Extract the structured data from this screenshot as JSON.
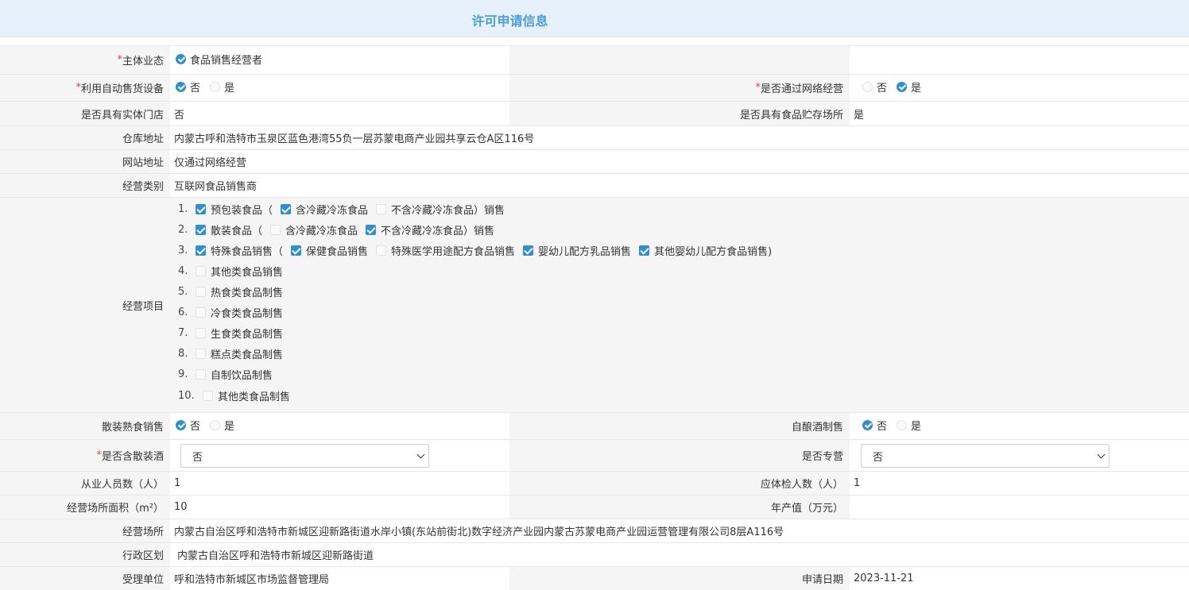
{
  "header": {
    "title": "许可申请信息"
  },
  "rows": {
    "subject": {
      "label": "主体业态",
      "option": "食品销售经营者"
    },
    "vending": {
      "label": "利用自动售货设备",
      "no": "否",
      "yes": "是"
    },
    "online": {
      "label": "是否通过网络经营",
      "no": "否",
      "yes": "是"
    },
    "store": {
      "label": "是否具有实体门店",
      "value": "否"
    },
    "storage": {
      "label": "是否具有食品贮存场所",
      "value": "是"
    },
    "warehouse": {
      "label": "仓库地址",
      "value": "内蒙古呼和浩特市玉泉区蓝色港湾55负一层苏蒙电商产业园共享云仓A区116号"
    },
    "website": {
      "label": "网站地址",
      "value": "仅通过网络经营"
    },
    "category": {
      "label": "经营类别",
      "value": "互联网食品销售商"
    },
    "items": {
      "label": "经营项目",
      "list": [
        {
          "num": "1.",
          "parts": [
            {
              "text": "预包装食品（",
              "checked": true
            },
            {
              "text": "含冷藏冷冻食品",
              "checked": true
            },
            {
              "text": "不含冷藏冷冻食品）销售",
              "checked": false
            }
          ]
        },
        {
          "num": "2.",
          "parts": [
            {
              "text": "散装食品（",
              "checked": true
            },
            {
              "text": "含冷藏冷冻食品",
              "checked": false
            },
            {
              "text": "不含冷藏冷冻食品）销售",
              "checked": true
            }
          ]
        },
        {
          "num": "3.",
          "parts": [
            {
              "text": "特殊食品销售（",
              "checked": true
            },
            {
              "text": "保健食品销售",
              "checked": true
            },
            {
              "text": "特殊医学用途配方食品销售",
              "checked": false
            },
            {
              "text": "婴幼儿配方乳品销售",
              "checked": true
            },
            {
              "text": "其他婴幼儿配方食品销售)",
              "checked": true
            }
          ]
        },
        {
          "num": "4.",
          "parts": [
            {
              "text": "其他类食品销售",
              "checked": false
            }
          ]
        },
        {
          "num": "5.",
          "parts": [
            {
              "text": "热食类食品制售",
              "checked": false
            }
          ]
        },
        {
          "num": "6.",
          "parts": [
            {
              "text": "冷食类食品制售",
              "checked": false
            }
          ]
        },
        {
          "num": "7.",
          "parts": [
            {
              "text": "生食类食品制售",
              "checked": false
            }
          ]
        },
        {
          "num": "8.",
          "parts": [
            {
              "text": "糕点类食品制售",
              "checked": false
            }
          ]
        },
        {
          "num": "9.",
          "parts": [
            {
              "text": "自制饮品制售",
              "checked": false
            }
          ]
        },
        {
          "num": "10.",
          "parts": [
            {
              "text": "其他类食品制售",
              "checked": false
            }
          ]
        }
      ]
    },
    "bulk_cooked": {
      "label": "散装熟食销售",
      "no": "否",
      "yes": "是"
    },
    "brewing": {
      "label": "自酿酒制售",
      "no": "否",
      "yes": "是"
    },
    "bulk_liquor": {
      "label": "是否含散装酒",
      "value": "否"
    },
    "specialty": {
      "label": "是否专营",
      "value": "否"
    },
    "staff": {
      "label": "从业人员数（人）",
      "value": "1"
    },
    "health_check": {
      "label": "应体检人数（人）",
      "value": "1"
    },
    "area": {
      "label": "经营场所面积（m²）",
      "value": "10"
    },
    "annual_output": {
      "label": "年产值（万元）",
      "value": ""
    },
    "premises": {
      "label": "经营场所",
      "value": "内蒙古自治区呼和浩特市新城区迎新路街道水岸小镇(东站前街北)数字经济产业园内蒙古苏蒙电商产业园运营管理有限公司8层A116号"
    },
    "district": {
      "label": "行政区划",
      "value": "内蒙古自治区呼和浩特市新城区迎新路街道"
    },
    "authority": {
      "label": "受理单位",
      "value": "呼和浩特市新城区市场监督管理局"
    },
    "apply_date": {
      "label": "申请日期",
      "value": "2023-11-21"
    }
  }
}
